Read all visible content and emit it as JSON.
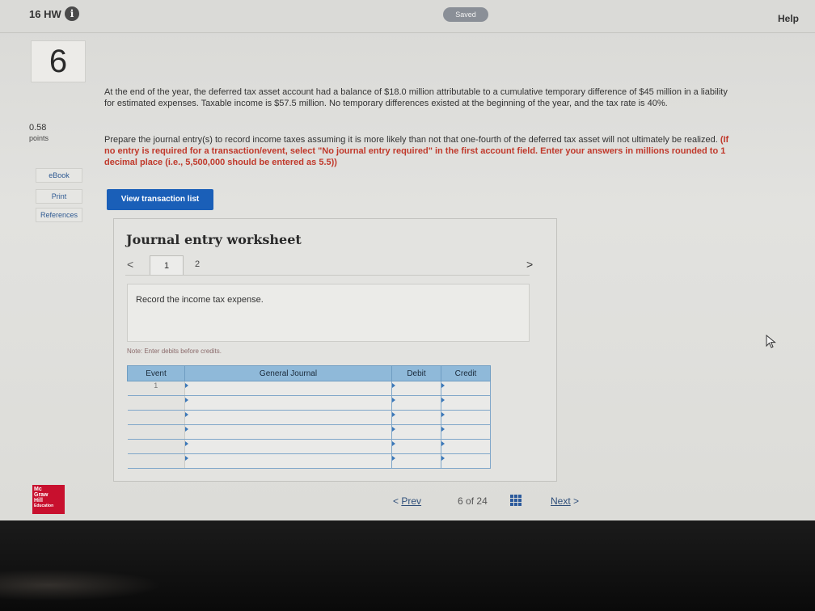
{
  "header": {
    "title": "16 HW",
    "info_glyph": "i",
    "status": "Saved",
    "help": "Help"
  },
  "question": {
    "number": "6",
    "points_value": "0.58",
    "points_label": "points",
    "paragraph1": "At the end of the year, the deferred tax asset account had a balance of $18.0 million attributable to a cumulative temporary difference of $45 million in a liability for estimated expenses. Taxable income is $57.5 million. No temporary differences existed at the beginning of the year, and the tax rate is 40%.",
    "paragraph2_main": "Prepare the journal entry(s) to record income taxes assuming it is more likely than not that one-fourth of the deferred tax asset will not ultimately be realized.",
    "paragraph2_red": "(If no entry is required for a transaction/event, select \"No journal entry required\" in the first account field. Enter your answers in millions rounded to 1 decimal place (i.e., 5,500,000 should be entered as 5.5))"
  },
  "sidebar": {
    "items": [
      {
        "label": "eBook"
      },
      {
        "label": "Print"
      },
      {
        "label": "References"
      }
    ]
  },
  "actions": {
    "view_transaction_list": "View transaction list"
  },
  "worksheet": {
    "title": "Journal entry worksheet",
    "prev_glyph": "<",
    "next_glyph": ">",
    "tabs": [
      "1",
      "2"
    ],
    "instruction": "Record the income tax expense.",
    "note": "Note: Enter debits before credits.",
    "columns": [
      "Event",
      "General Journal",
      "Debit",
      "Credit"
    ],
    "event_value": "1"
  },
  "pagination": {
    "prev": "Prev",
    "current": "6",
    "of": "of",
    "total": "24",
    "next": "Next"
  },
  "branding": {
    "lines": [
      "Mc",
      "Graw",
      "Hill",
      "Education"
    ]
  },
  "colors": {
    "accent": "#1a5fb8",
    "table_header": "#8fb9d9",
    "emphasis_red": "#c0392b"
  }
}
